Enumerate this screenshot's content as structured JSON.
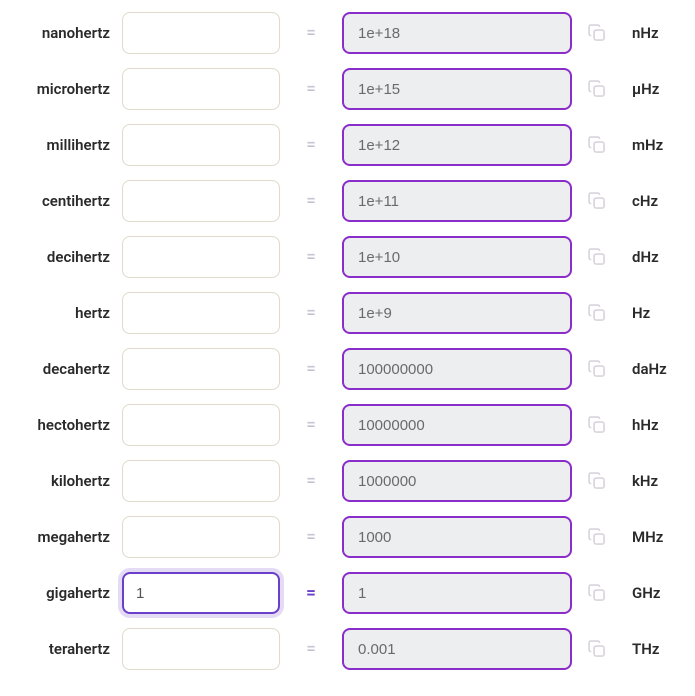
{
  "equals_sign": "=",
  "rows": [
    {
      "label": "nanohertz",
      "left_value": "",
      "right_value": "1e+18",
      "abbr": "nHz",
      "active": false
    },
    {
      "label": "microhertz",
      "left_value": "",
      "right_value": "1e+15",
      "abbr": "µHz",
      "active": false
    },
    {
      "label": "millihertz",
      "left_value": "",
      "right_value": "1e+12",
      "abbr": "mHz",
      "active": false
    },
    {
      "label": "centihertz",
      "left_value": "",
      "right_value": "1e+11",
      "abbr": "cHz",
      "active": false
    },
    {
      "label": "decihertz",
      "left_value": "",
      "right_value": "1e+10",
      "abbr": "dHz",
      "active": false
    },
    {
      "label": "hertz",
      "left_value": "",
      "right_value": "1e+9",
      "abbr": "Hz",
      "active": false
    },
    {
      "label": "decahertz",
      "left_value": "",
      "right_value": "100000000",
      "abbr": "daHz",
      "active": false
    },
    {
      "label": "hectohertz",
      "left_value": "",
      "right_value": "10000000",
      "abbr": "hHz",
      "active": false
    },
    {
      "label": "kilohertz",
      "left_value": "",
      "right_value": "1000000",
      "abbr": "kHz",
      "active": false
    },
    {
      "label": "megahertz",
      "left_value": "",
      "right_value": "1000",
      "abbr": "MHz",
      "active": false
    },
    {
      "label": "gigahertz",
      "left_value": "1",
      "right_value": "1",
      "abbr": "GHz",
      "active": true
    },
    {
      "label": "terahertz",
      "left_value": "",
      "right_value": "0.001",
      "abbr": "THz",
      "active": false
    }
  ]
}
